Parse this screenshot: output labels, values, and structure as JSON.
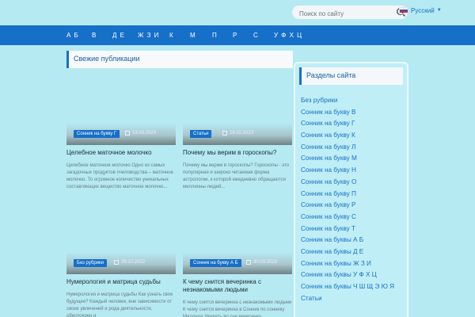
{
  "search": {
    "placeholder": "Поиск по сайту"
  },
  "language": {
    "label": "Русский"
  },
  "nav": [
    "А Б",
    "В",
    "Д Е",
    "Ж З И",
    "К",
    "М",
    "П",
    "Р",
    "С",
    "У Ф Х Ц"
  ],
  "main": {
    "section_title": "Свежие публикации"
  },
  "posts": [
    {
      "category": "Сонник на букву Г",
      "date": "23.03.2023",
      "title": "Целебное маточное молочко",
      "excerpt": "Целебное маточное молочко Одно из самых загадочных продуктов пчеловодства – маточное молочко. То огромное количество уникальных составляющих вещество маточное молочко..."
    },
    {
      "category": "Статьи",
      "date": "18.02.2023",
      "title": "Почему мы верим в гороскопы?",
      "excerpt": "Почему мы верим в гороскопы? Гороскопы - это популярная и широко читаемая форма астрологии, к которой ежедневно обращаются миллионы людей..."
    },
    {
      "category": "Без рубрики",
      "date": "29.10.2022",
      "title": "Нумерология и матрица судьбы",
      "excerpt": "Нумерология и матрица судьбы Как узнать свое будущее? Каждый человек, вне зависимости от своих увлечений и рода деятельности, обеспокоен и"
    },
    {
      "category": "Сонник на букву А Б",
      "date": "30.03.2020",
      "title": "К чему снится вечеринка с незнакомыми людьми",
      "excerpt": "К чему снится вечеринка с незнакомыми людьми К чему снится вечеринка в Сонник по соннику Миллера Увидеть во сне вечеринку"
    }
  ],
  "sidebar": {
    "title": "Разделы сайта",
    "items": [
      "Без рубрики",
      "Сонник на букву В",
      "Сонник на букву Г",
      "Сонник на букву К",
      "Сонник на букву Л",
      "Сонник на букву М",
      "Сонник на букву Н",
      "Сонник на букву О",
      "Сонник на букву П",
      "Сонник на букву Р",
      "Сонник на букву С",
      "Сонник на букву Т",
      "Сонник на буквы А Б",
      "Сонник на буквы Д Е",
      "Сонник на буквы Ж З И",
      "Сонник на буквы У Ф Х Ц",
      "Сонник на буквы Ч Ш Щ Э Ю Я",
      "Статьи"
    ]
  },
  "colors": {
    "accent": "#1670c8",
    "background": "#b6eaf3"
  },
  "icons": {
    "search": "search-icon",
    "flag": "russia-flag-icon",
    "dropdown": "caret-down-icon",
    "calendar": "calendar-icon"
  }
}
